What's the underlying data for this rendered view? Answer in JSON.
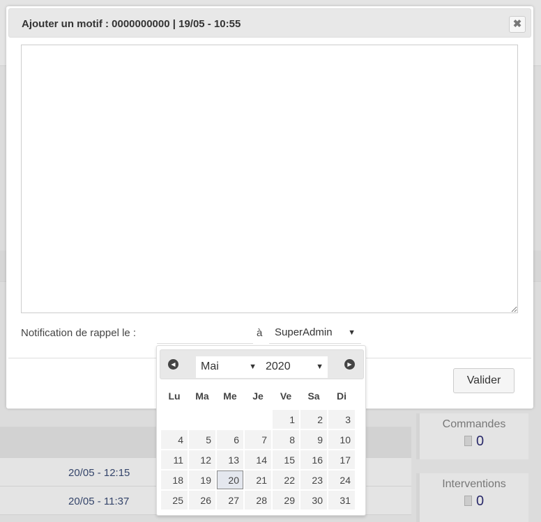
{
  "modal": {
    "title": "Ajouter un motif : 0000000000 | 19/05 - 10:55",
    "close_icon": "close-icon",
    "textarea_value": "",
    "notification_label": "Notification de rappel le :",
    "date_value": "",
    "a_label": "à",
    "user_select": "SuperAdmin",
    "validate_label": "Valider"
  },
  "datepicker": {
    "month": "Mai",
    "year": "2020",
    "weekdays": [
      "Lu",
      "Ma",
      "Me",
      "Je",
      "Ve",
      "Sa",
      "Di"
    ],
    "weeks": [
      [
        "",
        "",
        "",
        "",
        "1",
        "2",
        "3"
      ],
      [
        "4",
        "5",
        "6",
        "7",
        "8",
        "9",
        "10"
      ],
      [
        "11",
        "12",
        "13",
        "14",
        "15",
        "16",
        "17"
      ],
      [
        "18",
        "19",
        "20",
        "21",
        "22",
        "23",
        "24"
      ],
      [
        "25",
        "26",
        "27",
        "28",
        "29",
        "30",
        "31"
      ]
    ],
    "selected": "20"
  },
  "background": {
    "timestamps": [
      "20/05 - 12:15",
      "20/05 - 11:37"
    ],
    "cards": [
      {
        "label": "Commandes",
        "value": "0"
      },
      {
        "label": "Interventions",
        "value": "0"
      }
    ]
  }
}
